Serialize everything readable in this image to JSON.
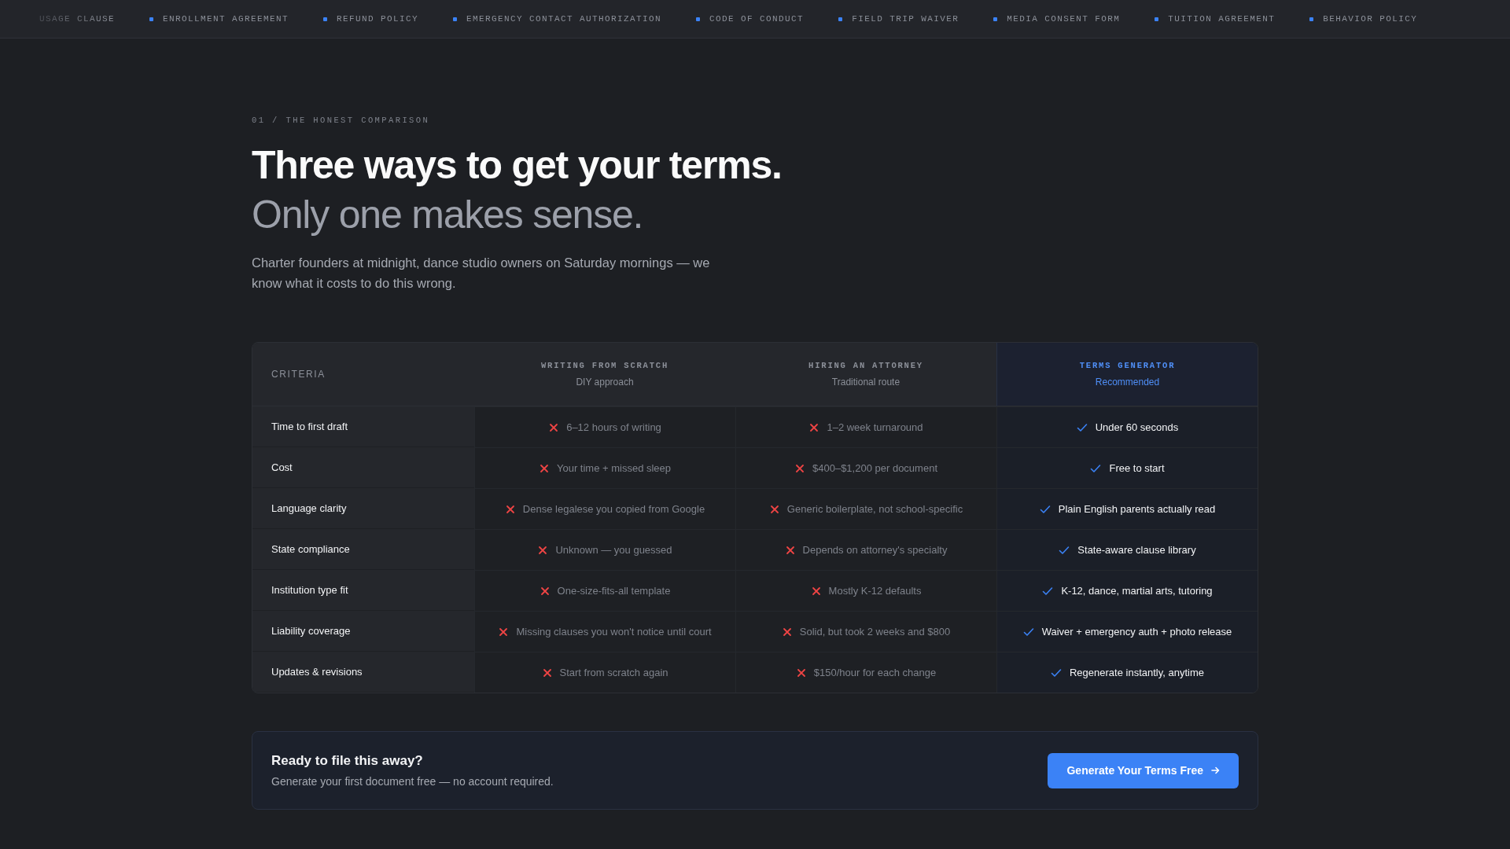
{
  "ticker": {
    "items": [
      {
        "label": "USAGE CLAUSE",
        "dot": false
      },
      {
        "label": "ENROLLMENT AGREEMENT",
        "dot": true
      },
      {
        "label": "REFUND POLICY",
        "dot": true
      },
      {
        "label": "EMERGENCY CONTACT AUTHORIZATION",
        "dot": true
      },
      {
        "label": "CODE OF CONDUCT",
        "dot": true
      },
      {
        "label": "FIELD TRIP WAIVER",
        "dot": true
      },
      {
        "label": "MEDIA CONSENT FORM",
        "dot": true
      },
      {
        "label": "TUITION AGREEMENT",
        "dot": true
      },
      {
        "label": "BEHAVIOR POLICY",
        "dot": true
      }
    ]
  },
  "section": {
    "eyebrow": "01 / THE HONEST COMPARISON",
    "title": "Three ways to get your terms.",
    "subtitle": "Only one makes sense.",
    "intro": "Charter founders at midnight, dance studio owners on Saturday mornings — we know what it costs to do this wrong."
  },
  "table": {
    "criteria_heading": "CRITERIA",
    "columns": [
      {
        "title": "WRITING FROM SCRATCH",
        "subtitle": "DIY approach",
        "recommended": false
      },
      {
        "title": "HIRING AN ATTORNEY",
        "subtitle": "Traditional route",
        "recommended": false
      },
      {
        "title": "TERMS GENERATOR",
        "subtitle": "Recommended",
        "recommended": true
      }
    ],
    "rows": [
      {
        "criterion": "Time to first draft",
        "cells": [
          {
            "text": "6–12 hours of writing",
            "kind": "cross"
          },
          {
            "text": "1–2 week turnaround",
            "kind": "cross"
          },
          {
            "text": "Under 60 seconds",
            "kind": "check"
          }
        ]
      },
      {
        "criterion": "Cost",
        "cells": [
          {
            "text": "Your time + missed sleep",
            "kind": "cross"
          },
          {
            "text": "$400–$1,200 per document",
            "kind": "cross"
          },
          {
            "text": "Free to start",
            "kind": "check"
          }
        ]
      },
      {
        "criterion": "Language clarity",
        "cells": [
          {
            "text": "Dense legalese you copied from Google",
            "kind": "cross"
          },
          {
            "text": "Generic boilerplate, not school-specific",
            "kind": "cross"
          },
          {
            "text": "Plain English parents actually read",
            "kind": "check"
          }
        ]
      },
      {
        "criterion": "State compliance",
        "cells": [
          {
            "text": "Unknown — you guessed",
            "kind": "cross"
          },
          {
            "text": "Depends on attorney's specialty",
            "kind": "cross"
          },
          {
            "text": "State-aware clause library",
            "kind": "check"
          }
        ]
      },
      {
        "criterion": "Institution type fit",
        "cells": [
          {
            "text": "One-size-fits-all template",
            "kind": "cross"
          },
          {
            "text": "Mostly K-12 defaults",
            "kind": "cross"
          },
          {
            "text": "K-12, dance, martial arts, tutoring",
            "kind": "check"
          }
        ]
      },
      {
        "criterion": "Liability coverage",
        "cells": [
          {
            "text": "Missing clauses you won't notice until court",
            "kind": "cross"
          },
          {
            "text": "Solid, but took 2 weeks and $800",
            "kind": "cross"
          },
          {
            "text": "Waiver + emergency auth + photo release",
            "kind": "check"
          }
        ]
      },
      {
        "criterion": "Updates & revisions",
        "cells": [
          {
            "text": "Start from scratch again",
            "kind": "cross"
          },
          {
            "text": "$150/hour for each change",
            "kind": "cross"
          },
          {
            "text": "Regenerate instantly, anytime",
            "kind": "check"
          }
        ]
      }
    ]
  },
  "cta": {
    "title": "Ready to file this away?",
    "text": "Generate your first document free — no account required.",
    "button": "Generate Your Terms Free"
  }
}
